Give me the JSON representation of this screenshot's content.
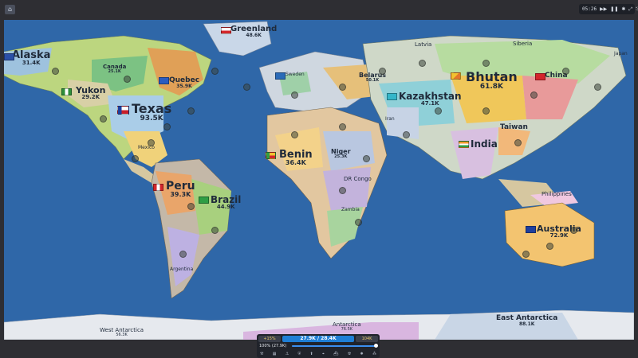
{
  "topbar": {
    "clock": "05:26",
    "home_icon": "home-icon",
    "icons": [
      "fast-forward-icon",
      "pause-icon",
      "settings-icon",
      "fullscreen-icon",
      "exit-icon"
    ]
  },
  "colors": {
    "ocean": "#2f67a8",
    "ice": "#e6e9ee",
    "accent": "#1f7fd6"
  },
  "countries": [
    {
      "id": "alaska",
      "name": "Alaska",
      "pop": "31.4K",
      "flag": "blue"
    },
    {
      "id": "greenland",
      "name": "Greenland",
      "pop": "48.6K",
      "flag": "white-red"
    },
    {
      "id": "canada",
      "name": "Canada",
      "pop": "25.1K",
      "flag": "red-white"
    },
    {
      "id": "quebec",
      "name": "Quebec",
      "pop": "35.9K",
      "flag": "blue-white"
    },
    {
      "id": "yukon",
      "name": "Yukon",
      "pop": "29.2K",
      "flag": "green"
    },
    {
      "id": "texas",
      "name": "Texas",
      "pop": "93.5K",
      "flag": "texas"
    },
    {
      "id": "mexico",
      "name": "Mexico",
      "pop": "",
      "flag": "green-white-red"
    },
    {
      "id": "peru",
      "name": "Peru",
      "pop": "39.3K",
      "flag": "red-white"
    },
    {
      "id": "brazil",
      "name": "Brazil",
      "pop": "44.9K",
      "flag": "green-yellow"
    },
    {
      "id": "argentina",
      "name": "Argentina",
      "pop": "",
      "flag": "blue-white"
    },
    {
      "id": "sweden",
      "name": "Sweden",
      "pop": "",
      "flag": "blue-yellow"
    },
    {
      "id": "latvia",
      "name": "Latvia",
      "pop": "",
      "flag": "red-white"
    },
    {
      "id": "belarus",
      "name": "Belarus",
      "pop": "50.1K",
      "flag": "red-green"
    },
    {
      "id": "siberia",
      "name": "Siberia",
      "pop": "",
      "flag": "white-blue"
    },
    {
      "id": "japan",
      "name": "Japan",
      "pop": "",
      "flag": "white-red"
    },
    {
      "id": "bhutan",
      "name": "Bhutan",
      "pop": "61.8K",
      "flag": "yellow-orange"
    },
    {
      "id": "china",
      "name": "China",
      "pop": "",
      "flag": "red"
    },
    {
      "id": "kazakhstan",
      "name": "Kazakhstan",
      "pop": "47.1K",
      "flag": "cyan"
    },
    {
      "id": "iran",
      "name": "Iran",
      "pop": "",
      "flag": "green-white-red"
    },
    {
      "id": "taiwan",
      "name": "Taiwan",
      "pop": "",
      "flag": "red-blue"
    },
    {
      "id": "india",
      "name": "India",
      "pop": "",
      "flag": "orange-white-green"
    },
    {
      "id": "benin",
      "name": "Benin",
      "pop": "36.4K",
      "flag": "green-yellow-red"
    },
    {
      "id": "niger",
      "name": "Niger",
      "pop": "25.3K",
      "flag": "orange-white-green"
    },
    {
      "id": "drcongo",
      "name": "DR Congo",
      "pop": "",
      "flag": "blue"
    },
    {
      "id": "zambia",
      "name": "Zambia",
      "pop": "",
      "flag": "green"
    },
    {
      "id": "philippines",
      "name": "Philippines",
      "pop": "",
      "flag": "blue-red"
    },
    {
      "id": "australia",
      "name": "Australia",
      "pop": "72.9K",
      "flag": "blue"
    },
    {
      "id": "west_antarctica",
      "name": "West Antarctica",
      "pop": "56.3K",
      "flag": "white"
    },
    {
      "id": "antarctica",
      "name": "Antarctica",
      "pop": "76.5K",
      "flag": "white"
    },
    {
      "id": "east_antarctica",
      "name": "East Antarctica",
      "pop": "88.1K",
      "flag": "white"
    }
  ],
  "hud": {
    "gold": "+15%",
    "troops": "27.9K / 28.4K",
    "income": "104K",
    "attack_ratio": "100% (27.9K)",
    "attack_ratio_fraction": 1.0,
    "tool_icons": [
      "build-icon",
      "city-icon",
      "port-icon",
      "defense-icon",
      "missile-silo-icon",
      "sam-icon",
      "warship-icon",
      "atom-bomb-icon",
      "hydrogen-bomb-icon",
      "mirv-icon"
    ]
  }
}
